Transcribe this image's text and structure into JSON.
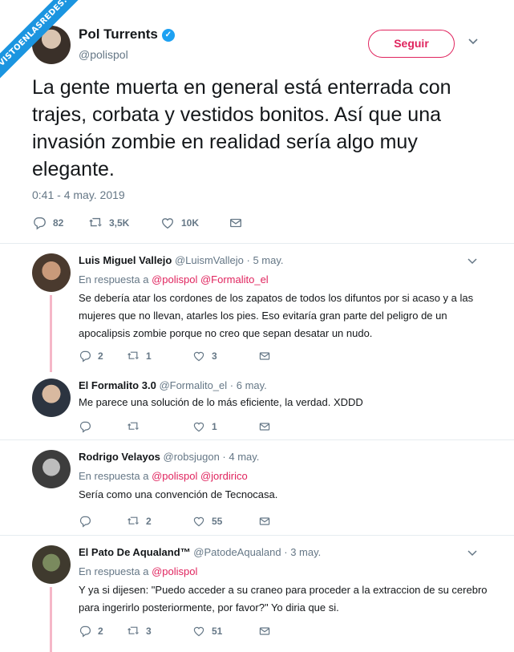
{
  "watermark": "VISTOENLASREDES.COM",
  "main_tweet": {
    "name": "Pol Turrents",
    "handle": "@polispol",
    "follow_label": "Seguir",
    "text": "La gente muerta en general está enterrada con trajes, corbata y vestidos bonitos. Así que una invasión zombie en realidad sería algo muy elegante.",
    "timestamp": "0:41 - 4 may. 2019",
    "replies": "82",
    "retweets": "3,5K",
    "likes": "10K"
  },
  "replies": [
    {
      "name": "Luis Miguel Vallejo",
      "handle": "@LuismVallejo",
      "date": "· 5 may.",
      "in_reply_prefix": "En respuesta a",
      "in_reply_mentions": "@polispol @Formalito_el",
      "text": "Se debería atar los cordones de los zapatos de todos los difuntos por si acaso y a las mujeres que no llevan, atarles los pies. Eso evitaría gran parte del peligro de un apocalipsis zombie porque no creo que sepan desatar un nudo.",
      "replies": "2",
      "retweets": "1",
      "likes": "3"
    },
    {
      "name": "El Formalito 3.0",
      "handle": "@Formalito_el",
      "date": "· 6 may.",
      "text": "Me parece una solución de lo más eficiente, la verdad. XDDD",
      "replies": "",
      "retweets": "",
      "likes": "1"
    },
    {
      "name": "Rodrigo Velayos",
      "handle": "@robsjugon",
      "date": "· 4 may.",
      "in_reply_prefix": "En respuesta a",
      "in_reply_mentions": "@polispol @jordirico",
      "text": "Sería como una convención de Tecnocasa.",
      "replies": "",
      "retweets": "2",
      "likes": "55"
    },
    {
      "name": "El Pato De Aqualand™",
      "handle": "@PatodeAqualand",
      "date": "· 3 may.",
      "in_reply_prefix": "En respuesta a",
      "in_reply_mentions": "@polispol",
      "text": "Y ya si dijesen: \"Puedo acceder a su craneo para proceder a la extraccion de su cerebro para ingerirlo posteriormente, por favor?\" Yo diria que si.",
      "replies": "2",
      "retweets": "3",
      "likes": "51"
    }
  ],
  "colors": {
    "accent": "#1da1f2",
    "follow": "#e0245e",
    "mention": "#e0245e",
    "thread_line": "#f5b7c8",
    "muted": "#657786"
  }
}
